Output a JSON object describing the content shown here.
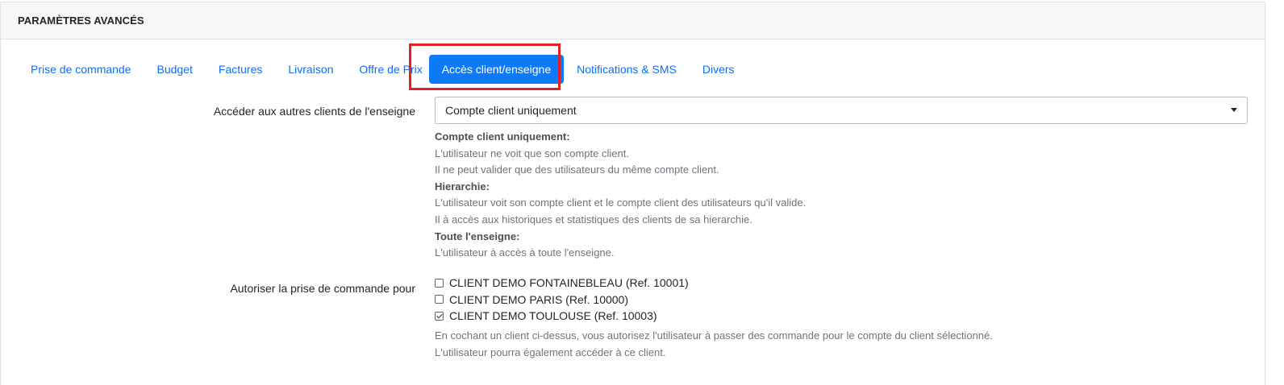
{
  "header": {
    "title": "PARAMÈTRES AVANCÉS"
  },
  "tabs": [
    {
      "label": "Prise de commande",
      "active": false
    },
    {
      "label": "Budget",
      "active": false
    },
    {
      "label": "Factures",
      "active": false
    },
    {
      "label": "Livraison",
      "active": false
    },
    {
      "label": "Offre de Prix",
      "active": false
    },
    {
      "label": "Accès client/enseigne",
      "active": true
    },
    {
      "label": "Notifications & SMS",
      "active": false
    },
    {
      "label": "Divers",
      "active": false
    }
  ],
  "access": {
    "label": "Accéder aux autres clients de l'enseigne",
    "selected": "Compte client uniquement",
    "help": {
      "h1": "Compte client uniquement:",
      "l1": "L'utilisateur ne voit que son compte client.",
      "l2": "Il ne peut valider que des utilisateurs du même compte client.",
      "h2": "Hierarchie:",
      "l3": "L'utilisateur voit son compte client et le compte client des utilisateurs qu'il valide.",
      "l4": "Il à accès aux historiques et statistiques des clients de sa hierarchie.",
      "h3": "Toute l'enseigne:",
      "l5": "L'utilisateur à accès à toute l'enseigne."
    }
  },
  "orders": {
    "label": "Autoriser la prise de commande pour",
    "clients": [
      {
        "label": "CLIENT DEMO FONTAINEBLEAU (Ref. 10001)",
        "checked": false
      },
      {
        "label": "CLIENT DEMO PARIS (Ref. 10000)",
        "checked": false
      },
      {
        "label": "CLIENT DEMO TOULOUSE (Ref. 10003)",
        "checked": true
      }
    ],
    "help1": "En cochant un client ci-dessus, vous autorisez l'utilisateur à passer des commande pour le compte du client sélectionné.",
    "help2": "L'utilisateur pourra également accéder à ce client."
  },
  "colors": {
    "accent": "#0d7bf8",
    "highlight": "#e0212a",
    "link": "#0d6efd"
  }
}
